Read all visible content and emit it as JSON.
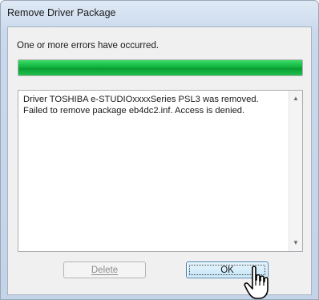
{
  "window": {
    "title": "Remove Driver Package"
  },
  "status": {
    "message": "One or more errors have occurred.",
    "progress_percent": 100,
    "progress_color": "#0fb43f"
  },
  "log": {
    "text": "Driver TOSHIBA e-STUDIOxxxxSeries PSL3 was removed.\nFailed to remove package eb4dc2.inf. Access is denied."
  },
  "buttons": {
    "delete_label": "Delete",
    "delete_enabled": false,
    "ok_label": "OK"
  },
  "icons": {
    "cursor": "hand-pointer-icon",
    "scroll_up": "scroll-up-arrow-icon",
    "scroll_down": "scroll-down-arrow-icon"
  }
}
